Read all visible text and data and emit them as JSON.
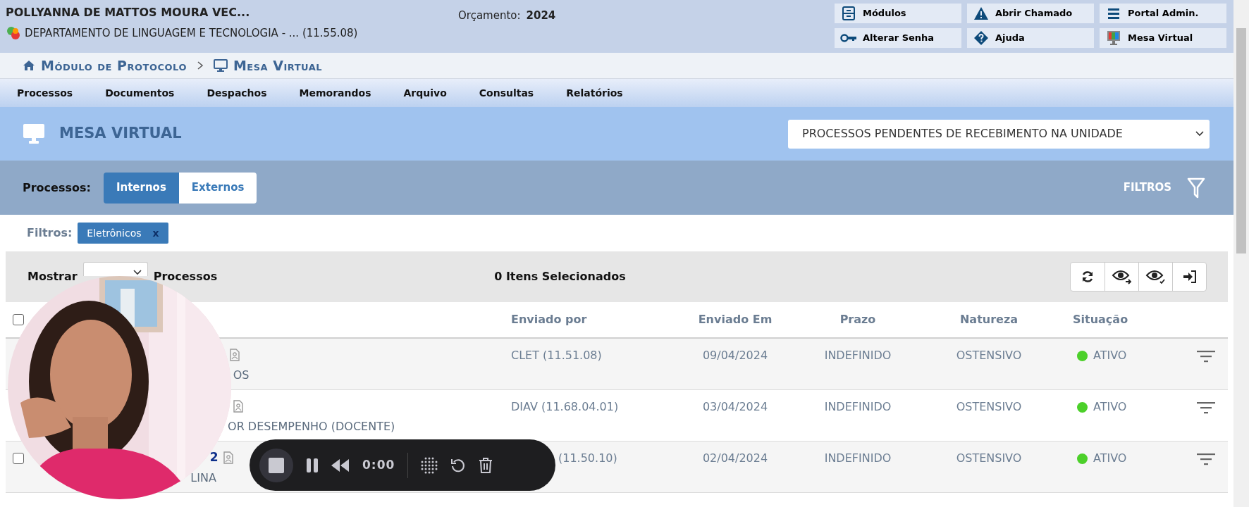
{
  "header": {
    "user_name": "POLLYANNA DE MATTOS MOURA VEC...",
    "unit": "DEPARTAMENTO DE LINGUAGEM E TECNOLOGIA - ... (11.55.08)",
    "budget_label": "Orçamento:",
    "budget_year": "2024"
  },
  "quick_links": [
    {
      "label": "Módulos"
    },
    {
      "label": "Abrir Chamado"
    },
    {
      "label": "Portal Admin."
    },
    {
      "label": "Alterar Senha"
    },
    {
      "label": "Ajuda"
    },
    {
      "label": "Mesa Virtual"
    }
  ],
  "breadcrumb": [
    "Módulo de Protocolo",
    "Mesa Virtual"
  ],
  "menu": [
    "Processos",
    "Documentos",
    "Despachos",
    "Memorandos",
    "Arquivo",
    "Consultas",
    "Relatórios"
  ],
  "page_title": "MESA VIRTUAL",
  "view_select": {
    "value": "PROCESSOS PENDENTES DE RECEBIMENTO NA UNIDADE"
  },
  "process_type": {
    "label": "Processos:",
    "options": [
      {
        "label": "Internos",
        "selected": true
      },
      {
        "label": "Externos",
        "selected": false
      }
    ]
  },
  "filters_button": "FILTROS",
  "active_filters": {
    "label": "Filtros:",
    "tags": [
      {
        "label": "Eletrônicos",
        "remove": "x"
      }
    ]
  },
  "toolbar": {
    "show_label": "Mostrar",
    "unit": "Processos",
    "selection": "0 Itens Selecionados"
  },
  "table": {
    "header_checkbox": {
      "checked": false
    },
    "columns": [
      "Enviado por",
      "Enviado Em",
      "Prazo",
      "Natureza",
      "Situação"
    ],
    "rows": [
      {
        "subject": "OS",
        "sent_by": "CLET (11.51.08)",
        "sent_at": "09/04/2024",
        "deadline": "INDEFINIDO",
        "nature": "OSTENSIVO",
        "status": "ATIVO",
        "color": "#4cd02a"
      },
      {
        "subject": "OR DESEMPENHO (DOCENTE)",
        "sent_by": "DIAV (11.68.04.01)",
        "sent_at": "03/04/2024",
        "deadline": "INDEFINIDO",
        "nature": "OSTENSIVO",
        "status": "ATIVO",
        "color": "#4cd02a"
      },
      {
        "checked": false,
        "number": "2",
        "subject": "LINA",
        "sent_by": "(11.50.10)",
        "sent_at": "02/04/2024",
        "deadline": "INDEFINIDO",
        "nature": "OSTENSIVO",
        "status": "ATIVO",
        "color": "#4cd02a"
      }
    ]
  },
  "recorder": {
    "time": "0:00"
  }
}
